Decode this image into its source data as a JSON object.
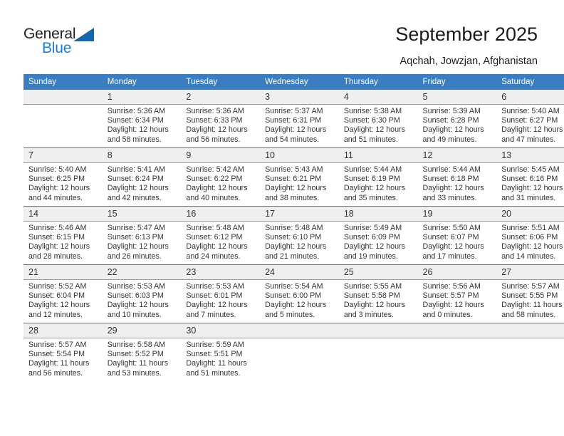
{
  "brand": {
    "name_part1": "General",
    "name_part2": "Blue",
    "triangle_color": "#1267b0",
    "blue_color": "#1a7fd4"
  },
  "header": {
    "title": "September 2025",
    "location": "Aqchah, Jowzjan, Afghanistan"
  },
  "theme": {
    "header_blue": "#3a7ebf",
    "daynum_band": "#efefef",
    "text": "#333333"
  },
  "weekdays": [
    "Sunday",
    "Monday",
    "Tuesday",
    "Wednesday",
    "Thursday",
    "Friday",
    "Saturday"
  ],
  "weeks": [
    [
      {
        "day": "",
        "sunrise": "",
        "sunset": "",
        "daylight1": "",
        "daylight2": ""
      },
      {
        "day": "1",
        "sunrise": "Sunrise: 5:36 AM",
        "sunset": "Sunset: 6:34 PM",
        "daylight1": "Daylight: 12 hours",
        "daylight2": "and 58 minutes."
      },
      {
        "day": "2",
        "sunrise": "Sunrise: 5:36 AM",
        "sunset": "Sunset: 6:33 PM",
        "daylight1": "Daylight: 12 hours",
        "daylight2": "and 56 minutes."
      },
      {
        "day": "3",
        "sunrise": "Sunrise: 5:37 AM",
        "sunset": "Sunset: 6:31 PM",
        "daylight1": "Daylight: 12 hours",
        "daylight2": "and 54 minutes."
      },
      {
        "day": "4",
        "sunrise": "Sunrise: 5:38 AM",
        "sunset": "Sunset: 6:30 PM",
        "daylight1": "Daylight: 12 hours",
        "daylight2": "and 51 minutes."
      },
      {
        "day": "5",
        "sunrise": "Sunrise: 5:39 AM",
        "sunset": "Sunset: 6:28 PM",
        "daylight1": "Daylight: 12 hours",
        "daylight2": "and 49 minutes."
      },
      {
        "day": "6",
        "sunrise": "Sunrise: 5:40 AM",
        "sunset": "Sunset: 6:27 PM",
        "daylight1": "Daylight: 12 hours",
        "daylight2": "and 47 minutes."
      }
    ],
    [
      {
        "day": "7",
        "sunrise": "Sunrise: 5:40 AM",
        "sunset": "Sunset: 6:25 PM",
        "daylight1": "Daylight: 12 hours",
        "daylight2": "and 44 minutes."
      },
      {
        "day": "8",
        "sunrise": "Sunrise: 5:41 AM",
        "sunset": "Sunset: 6:24 PM",
        "daylight1": "Daylight: 12 hours",
        "daylight2": "and 42 minutes."
      },
      {
        "day": "9",
        "sunrise": "Sunrise: 5:42 AM",
        "sunset": "Sunset: 6:22 PM",
        "daylight1": "Daylight: 12 hours",
        "daylight2": "and 40 minutes."
      },
      {
        "day": "10",
        "sunrise": "Sunrise: 5:43 AM",
        "sunset": "Sunset: 6:21 PM",
        "daylight1": "Daylight: 12 hours",
        "daylight2": "and 38 minutes."
      },
      {
        "day": "11",
        "sunrise": "Sunrise: 5:44 AM",
        "sunset": "Sunset: 6:19 PM",
        "daylight1": "Daylight: 12 hours",
        "daylight2": "and 35 minutes."
      },
      {
        "day": "12",
        "sunrise": "Sunrise: 5:44 AM",
        "sunset": "Sunset: 6:18 PM",
        "daylight1": "Daylight: 12 hours",
        "daylight2": "and 33 minutes."
      },
      {
        "day": "13",
        "sunrise": "Sunrise: 5:45 AM",
        "sunset": "Sunset: 6:16 PM",
        "daylight1": "Daylight: 12 hours",
        "daylight2": "and 31 minutes."
      }
    ],
    [
      {
        "day": "14",
        "sunrise": "Sunrise: 5:46 AM",
        "sunset": "Sunset: 6:15 PM",
        "daylight1": "Daylight: 12 hours",
        "daylight2": "and 28 minutes."
      },
      {
        "day": "15",
        "sunrise": "Sunrise: 5:47 AM",
        "sunset": "Sunset: 6:13 PM",
        "daylight1": "Daylight: 12 hours",
        "daylight2": "and 26 minutes."
      },
      {
        "day": "16",
        "sunrise": "Sunrise: 5:48 AM",
        "sunset": "Sunset: 6:12 PM",
        "daylight1": "Daylight: 12 hours",
        "daylight2": "and 24 minutes."
      },
      {
        "day": "17",
        "sunrise": "Sunrise: 5:48 AM",
        "sunset": "Sunset: 6:10 PM",
        "daylight1": "Daylight: 12 hours",
        "daylight2": "and 21 minutes."
      },
      {
        "day": "18",
        "sunrise": "Sunrise: 5:49 AM",
        "sunset": "Sunset: 6:09 PM",
        "daylight1": "Daylight: 12 hours",
        "daylight2": "and 19 minutes."
      },
      {
        "day": "19",
        "sunrise": "Sunrise: 5:50 AM",
        "sunset": "Sunset: 6:07 PM",
        "daylight1": "Daylight: 12 hours",
        "daylight2": "and 17 minutes."
      },
      {
        "day": "20",
        "sunrise": "Sunrise: 5:51 AM",
        "sunset": "Sunset: 6:06 PM",
        "daylight1": "Daylight: 12 hours",
        "daylight2": "and 14 minutes."
      }
    ],
    [
      {
        "day": "21",
        "sunrise": "Sunrise: 5:52 AM",
        "sunset": "Sunset: 6:04 PM",
        "daylight1": "Daylight: 12 hours",
        "daylight2": "and 12 minutes."
      },
      {
        "day": "22",
        "sunrise": "Sunrise: 5:53 AM",
        "sunset": "Sunset: 6:03 PM",
        "daylight1": "Daylight: 12 hours",
        "daylight2": "and 10 minutes."
      },
      {
        "day": "23",
        "sunrise": "Sunrise: 5:53 AM",
        "sunset": "Sunset: 6:01 PM",
        "daylight1": "Daylight: 12 hours",
        "daylight2": "and 7 minutes."
      },
      {
        "day": "24",
        "sunrise": "Sunrise: 5:54 AM",
        "sunset": "Sunset: 6:00 PM",
        "daylight1": "Daylight: 12 hours",
        "daylight2": "and 5 minutes."
      },
      {
        "day": "25",
        "sunrise": "Sunrise: 5:55 AM",
        "sunset": "Sunset: 5:58 PM",
        "daylight1": "Daylight: 12 hours",
        "daylight2": "and 3 minutes."
      },
      {
        "day": "26",
        "sunrise": "Sunrise: 5:56 AM",
        "sunset": "Sunset: 5:57 PM",
        "daylight1": "Daylight: 12 hours",
        "daylight2": "and 0 minutes."
      },
      {
        "day": "27",
        "sunrise": "Sunrise: 5:57 AM",
        "sunset": "Sunset: 5:55 PM",
        "daylight1": "Daylight: 11 hours",
        "daylight2": "and 58 minutes."
      }
    ],
    [
      {
        "day": "28",
        "sunrise": "Sunrise: 5:57 AM",
        "sunset": "Sunset: 5:54 PM",
        "daylight1": "Daylight: 11 hours",
        "daylight2": "and 56 minutes."
      },
      {
        "day": "29",
        "sunrise": "Sunrise: 5:58 AM",
        "sunset": "Sunset: 5:52 PM",
        "daylight1": "Daylight: 11 hours",
        "daylight2": "and 53 minutes."
      },
      {
        "day": "30",
        "sunrise": "Sunrise: 5:59 AM",
        "sunset": "Sunset: 5:51 PM",
        "daylight1": "Daylight: 11 hours",
        "daylight2": "and 51 minutes."
      },
      {
        "day": "",
        "sunrise": "",
        "sunset": "",
        "daylight1": "",
        "daylight2": ""
      },
      {
        "day": "",
        "sunrise": "",
        "sunset": "",
        "daylight1": "",
        "daylight2": ""
      },
      {
        "day": "",
        "sunrise": "",
        "sunset": "",
        "daylight1": "",
        "daylight2": ""
      },
      {
        "day": "",
        "sunrise": "",
        "sunset": "",
        "daylight1": "",
        "daylight2": ""
      }
    ]
  ]
}
